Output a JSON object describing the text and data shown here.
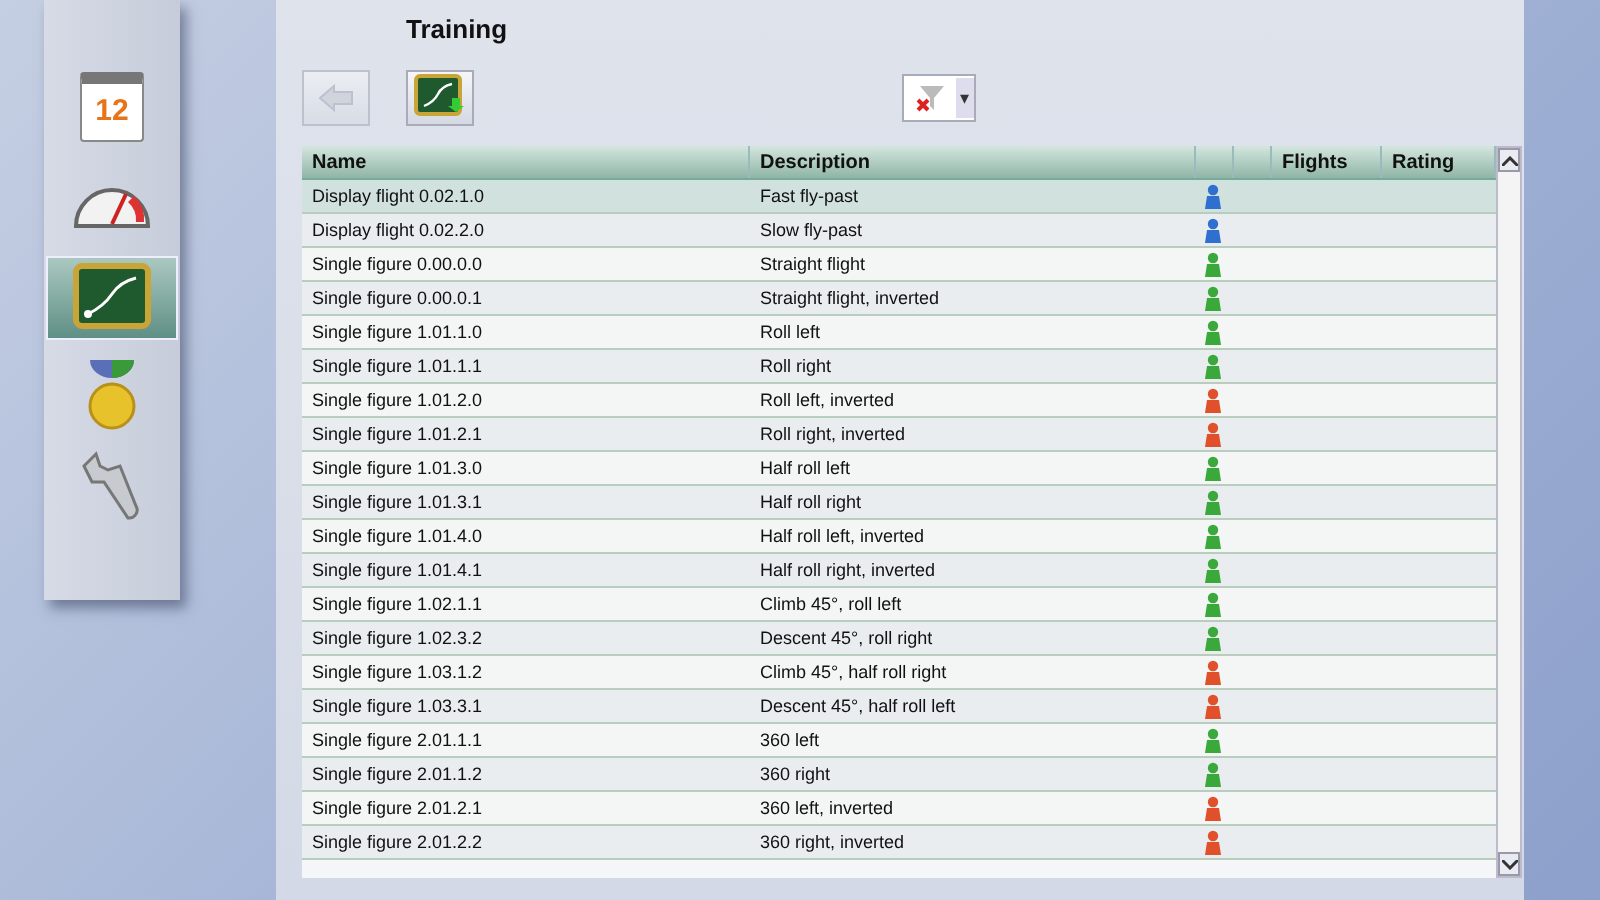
{
  "sidebar": {
    "items": [
      {
        "kind": "calendar",
        "label": "12",
        "selected": false
      },
      {
        "kind": "gauge",
        "selected": false
      },
      {
        "kind": "board",
        "selected": true
      },
      {
        "kind": "medal",
        "selected": false
      },
      {
        "kind": "wrench",
        "selected": false
      }
    ]
  },
  "title": "Training",
  "toolbar": {
    "back": {
      "disabled": true
    },
    "filter_caret": "▾"
  },
  "table": {
    "columns": [
      "Name",
      "Description",
      "",
      "",
      "Flights",
      "Rating"
    ],
    "rows": [
      {
        "name": "Display flight 0.02.1.0",
        "description": "Fast fly-past",
        "color": "#2f6fd0",
        "selected": true
      },
      {
        "name": "Display flight 0.02.2.0",
        "description": "Slow fly-past",
        "color": "#2f6fd0",
        "selected": false
      },
      {
        "name": "Single figure 0.00.0.0",
        "description": "Straight flight",
        "color": "#3aa83a",
        "selected": false
      },
      {
        "name": "Single figure 0.00.0.1",
        "description": "Straight flight, inverted",
        "color": "#3aa83a",
        "selected": false
      },
      {
        "name": "Single figure 1.01.1.0",
        "description": "Roll left",
        "color": "#3aa83a",
        "selected": false
      },
      {
        "name": "Single figure 1.01.1.1",
        "description": "Roll right",
        "color": "#3aa83a",
        "selected": false
      },
      {
        "name": "Single figure 1.01.2.0",
        "description": "Roll left, inverted",
        "color": "#e0502a",
        "selected": false
      },
      {
        "name": "Single figure 1.01.2.1",
        "description": "Roll right, inverted",
        "color": "#e0502a",
        "selected": false
      },
      {
        "name": "Single figure 1.01.3.0",
        "description": "Half roll left",
        "color": "#3aa83a",
        "selected": false
      },
      {
        "name": "Single figure 1.01.3.1",
        "description": "Half roll right",
        "color": "#3aa83a",
        "selected": false
      },
      {
        "name": "Single figure 1.01.4.0",
        "description": "Half roll left, inverted",
        "color": "#3aa83a",
        "selected": false
      },
      {
        "name": "Single figure 1.01.4.1",
        "description": "Half roll right, inverted",
        "color": "#3aa83a",
        "selected": false
      },
      {
        "name": "Single figure 1.02.1.1",
        "description": "Climb 45°, roll left",
        "color": "#3aa83a",
        "selected": false
      },
      {
        "name": "Single figure 1.02.3.2",
        "description": "Descent 45°, roll right",
        "color": "#3aa83a",
        "selected": false
      },
      {
        "name": "Single figure 1.03.1.2",
        "description": "Climb 45°, half roll right",
        "color": "#e0502a",
        "selected": false
      },
      {
        "name": "Single figure 1.03.3.1",
        "description": "Descent 45°, half roll left",
        "color": "#e0502a",
        "selected": false
      },
      {
        "name": "Single figure 2.01.1.1",
        "description": "360 left",
        "color": "#3aa83a",
        "selected": false
      },
      {
        "name": "Single figure 2.01.1.2",
        "description": "360 right",
        "color": "#3aa83a",
        "selected": false
      },
      {
        "name": "Single figure 2.01.2.1",
        "description": "360 left, inverted",
        "color": "#e0502a",
        "selected": false
      },
      {
        "name": "Single figure 2.01.2.2",
        "description": "360 right, inverted",
        "color": "#e0502a",
        "selected": false
      }
    ]
  }
}
